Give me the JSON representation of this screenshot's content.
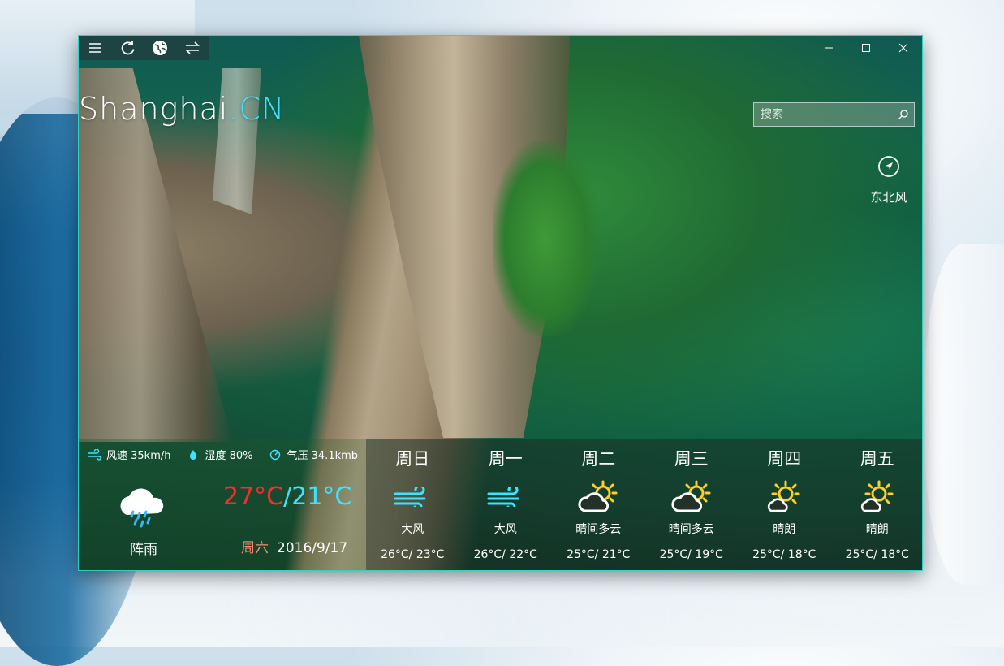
{
  "toolbar": {
    "menu": "hamburger-icon",
    "refresh": "refresh-icon",
    "globe": "globe-icon",
    "switch": "switch-icon"
  },
  "city": {
    "name": "Shanghai",
    "suffix": ".CN"
  },
  "search": {
    "placeholder": "搜索"
  },
  "wind_direction": {
    "label": "东北风"
  },
  "current": {
    "wind_speed": "风速 35km/h",
    "humidity": "湿度 80%",
    "pressure": "气压 34.1kmb",
    "condition": "阵雨",
    "temp_high": "27°C",
    "separator": "/",
    "temp_low": "21°C",
    "weekday": "周六",
    "date": "2016/9/17"
  },
  "forecast": [
    {
      "day": "周日",
      "icon": "wind-icon",
      "condition": "大风",
      "range": "26°C/ 23°C"
    },
    {
      "day": "周一",
      "icon": "wind-icon",
      "condition": "大风",
      "range": "26°C/ 22°C"
    },
    {
      "day": "周二",
      "icon": "partly-cloudy-icon",
      "condition": "晴间多云",
      "range": "25°C/ 21°C"
    },
    {
      "day": "周三",
      "icon": "partly-cloudy-icon",
      "condition": "晴间多云",
      "range": "25°C/ 19°C"
    },
    {
      "day": "周四",
      "icon": "sunny-icon",
      "condition": "晴朗",
      "range": "25°C/ 18°C"
    },
    {
      "day": "周五",
      "icon": "sunny-icon",
      "condition": "晴朗",
      "range": "25°C/ 18°C"
    }
  ],
  "colors": {
    "accent": "#3fe3ff",
    "high_temp": "#ff2a2a",
    "weekday": "#ff8b73",
    "border": "#2fd2c0"
  }
}
